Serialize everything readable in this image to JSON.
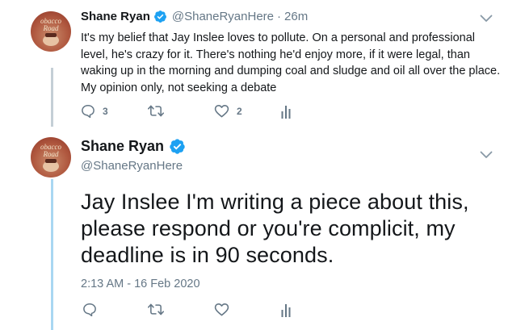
{
  "tweet1": {
    "author_name": "Shane Ryan",
    "handle": "@ShaneRyanHere",
    "separator": "·",
    "time": "26m",
    "avatar_text_line1": "obacco",
    "avatar_text_line2": "Road",
    "text": "It's my belief that Jay Inslee loves to pollute. On a personal and professional level, he's crazy for it. There's nothing he'd enjoy more, if it were legal, than waking up in the morning and dumping coal and sludge and oil all over the place. My opinion only, not seeking a debate",
    "reply_count": "3",
    "retweet_count": "",
    "like_count": "2"
  },
  "tweet2": {
    "author_name": "Shane Ryan",
    "handle": "@ShaneRyanHere",
    "avatar_text_line1": "obacco",
    "avatar_text_line2": "Road",
    "text": "Jay Inslee I'm writing a piece about this, please respond or you're complicit, my deadline is in 90 seconds.",
    "timestamp": "2:13 AM - 16 Feb 2020"
  },
  "icons": {
    "verified": "verified-badge-icon",
    "reply": "reply-icon",
    "retweet": "retweet-icon",
    "like": "heart-icon",
    "analytics": "analytics-icon",
    "menu": "chevron-down-icon"
  },
  "colors": {
    "text": "#14171a",
    "secondary": "#657786",
    "verified": "#1da1f2",
    "thread_line": "#c4cfd6"
  }
}
